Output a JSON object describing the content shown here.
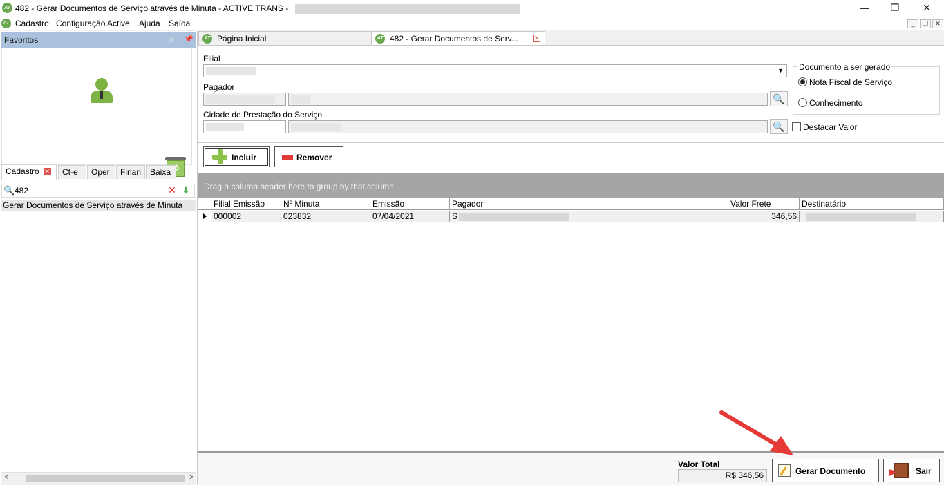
{
  "window": {
    "title": "482 - Gerar Documentos de Serviço através de Minuta - ACTIVE TRANS -",
    "logo_text": "AT",
    "minimize_glyph": "—",
    "maximize_glyph": "❐",
    "close_glyph": "✕"
  },
  "menu": {
    "items": [
      "Cadastro",
      "Configuração Active",
      "Ajuda",
      "Saída"
    ]
  },
  "favorites": {
    "title": "Favoritos"
  },
  "left_tabs": [
    "Cadastro",
    "Ct-e",
    "Oper",
    "Finan",
    "Baixa"
  ],
  "search": {
    "value": "482"
  },
  "search_results": [
    "Gerar Documentos de Serviço através de Minuta"
  ],
  "doc_tabs": [
    {
      "label": "Página Inicial"
    },
    {
      "label": "482 - Gerar Documentos de Serv..."
    }
  ],
  "form": {
    "filial_label": "Filial",
    "pagador_label": "Pagador",
    "cidade_label": "Cidade de Prestação do Serviço",
    "documento_group_label": "Documento a ser gerado",
    "options": [
      "Nota Fiscal de Serviço",
      "Conhecimento"
    ],
    "selected_option": "Nota Fiscal de Serviço",
    "destacar_label": "Destacar Valor"
  },
  "buttons": {
    "incluir": "Incluir",
    "remover": "Remover",
    "gerar": "Gerar Documento",
    "sair": "Sair"
  },
  "grid": {
    "group_hint": "Drag a column header here to group by that column",
    "columns": [
      "Filial Emissão",
      "Nº Minuta",
      "Emissão",
      "Pagador",
      "Valor Frete",
      "Destinatário"
    ],
    "rows": [
      {
        "filial": "000002",
        "minuta": "023832",
        "emissao": "07/04/2021",
        "pagador": "S",
        "valor_frete": "346,56",
        "destinatario": ""
      }
    ]
  },
  "totals": {
    "label": "Valor Total",
    "value": "R$ 346,56"
  },
  "colors": {
    "accent_green": "#6aa84f",
    "favorites_header": "#a9c1dc",
    "group_bar": "#a5a5a5",
    "annotation_arrow": "#e53935"
  }
}
